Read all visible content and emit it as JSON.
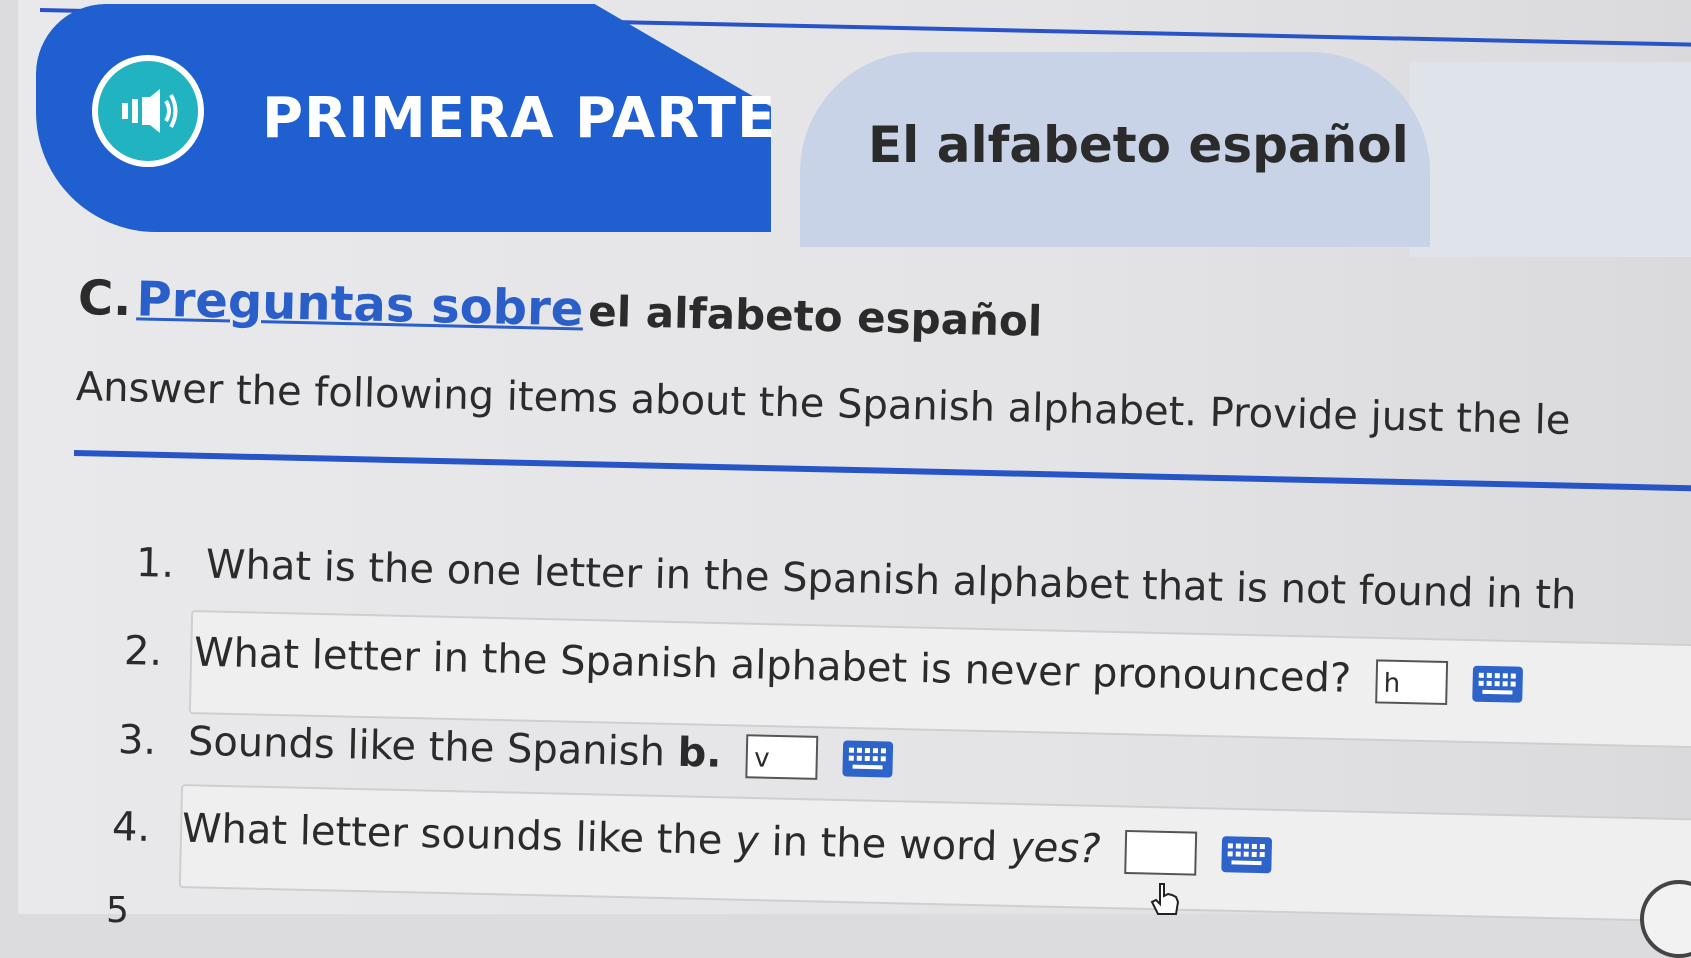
{
  "header": {
    "section_label": "PRIMERA PARTE",
    "lesson_title": "El alfabeto español"
  },
  "section": {
    "letter": "C.",
    "link_text": "Preguntas sobre",
    "rest_title": "el alfabeto español",
    "instructions": "Answer the following items about the Spanish alphabet. Provide just the le"
  },
  "questions": [
    {
      "num": "1.",
      "text": "What is the one letter in the Spanish alphabet that is not found in th"
    },
    {
      "num": "2.",
      "text": "What letter in the Spanish alphabet is never pronounced?",
      "answer": "h"
    },
    {
      "num": "3.",
      "text_prefix": "Sounds like the Spanish ",
      "text_bold": "b.",
      "answer": "v"
    },
    {
      "num": "4.",
      "text_prefix": "What letter sounds like the ",
      "text_italic_1": "y",
      "text_mid": " in the word ",
      "text_italic_2": "yes?",
      "answer": ""
    },
    {
      "num": "5"
    }
  ],
  "icons": {
    "audio": "speaker-icon",
    "keyboard": "keyboard-icon",
    "cursor": "hand-pointer-icon"
  },
  "colors": {
    "brand_blue": "#1f5fd0",
    "speaker_teal": "#21b3bf",
    "link_blue": "#2a5ec9"
  }
}
